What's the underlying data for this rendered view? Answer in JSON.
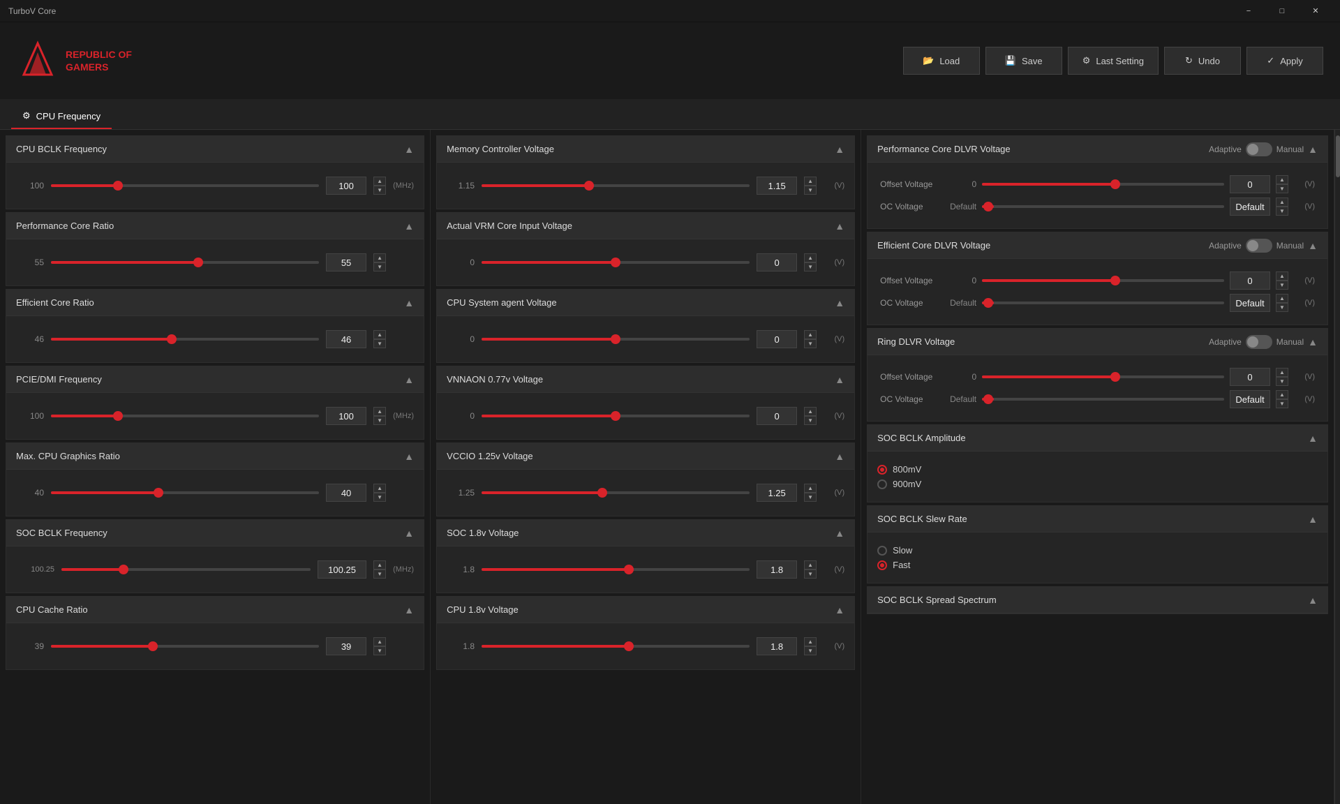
{
  "app": {
    "title": "TurboV Core",
    "titlebar_controls": [
      "minimize",
      "maximize",
      "close"
    ]
  },
  "toolbar": {
    "load_label": "Load",
    "save_label": "Save",
    "last_setting_label": "Last Setting",
    "undo_label": "Undo",
    "apply_label": "Apply"
  },
  "nav": {
    "tabs": [
      {
        "id": "cpu-frequency",
        "label": "CPU Frequency",
        "active": true
      }
    ]
  },
  "col1": {
    "sections": [
      {
        "id": "cpu-bclk-freq",
        "title": "CPU BCLK Frequency",
        "value": "100",
        "display": "100",
        "unit": "(MHz)",
        "fill_pct": 25
      },
      {
        "id": "perf-core-ratio",
        "title": "Performance Core Ratio",
        "value": "55",
        "display": "55",
        "unit": "",
        "fill_pct": 55
      },
      {
        "id": "eff-core-ratio",
        "title": "Efficient Core Ratio",
        "value": "46",
        "display": "46",
        "unit": "",
        "fill_pct": 45
      },
      {
        "id": "pcie-dmi-freq",
        "title": "PCIE/DMI Frequency",
        "value": "100",
        "display": "100",
        "unit": "(MHz)",
        "fill_pct": 25
      },
      {
        "id": "max-cpu-graphics",
        "title": "Max. CPU Graphics Ratio",
        "value": "40",
        "display": "40",
        "unit": "",
        "fill_pct": 40
      },
      {
        "id": "soc-bclk-freq",
        "title": "SOC BCLK Frequency",
        "value": "100.25",
        "display": "100.25",
        "unit": "(MHz)",
        "fill_pct": 25
      },
      {
        "id": "cpu-cache-ratio",
        "title": "CPU Cache Ratio",
        "value": "39",
        "display": "39",
        "unit": "",
        "fill_pct": 38
      }
    ]
  },
  "col2": {
    "sections": [
      {
        "id": "mem-ctrl-voltage",
        "title": "Memory Controller Voltage",
        "value": "1.15",
        "display": "1.15",
        "unit": "(V)",
        "fill_pct": 40
      },
      {
        "id": "actual-vrm-voltage",
        "title": "Actual VRM Core Input Voltage",
        "value": "0",
        "display": "0",
        "unit": "(V)",
        "fill_pct": 50
      },
      {
        "id": "cpu-sysagent-voltage",
        "title": "CPU System agent Voltage",
        "value": "0",
        "display": "0",
        "unit": "(V)",
        "fill_pct": 50
      },
      {
        "id": "vnnaon-voltage",
        "title": "VNNAON 0.77v Voltage",
        "value": "0",
        "display": "0",
        "unit": "(V)",
        "fill_pct": 50
      },
      {
        "id": "vccio-voltage",
        "title": "VCCIO 1.25v Voltage",
        "value": "1.25",
        "display": "1.25",
        "unit": "(V)",
        "fill_pct": 45
      },
      {
        "id": "soc-18v-voltage",
        "title": "SOC 1.8v Voltage",
        "value": "1.8",
        "display": "1.8",
        "unit": "(V)",
        "fill_pct": 55
      },
      {
        "id": "cpu-18v-voltage",
        "title": "CPU 1.8v Voltage",
        "value": "1.8",
        "display": "1.8",
        "unit": "(V)",
        "fill_pct": 55
      }
    ]
  },
  "col3": {
    "perf_core_dlvr": {
      "title": "Performance Core DLVR Voltage",
      "toggle_left": "Adaptive",
      "toggle_right": "Manual",
      "offset_label": "Offset Voltage",
      "offset_value": "0",
      "offset_display": "0",
      "offset_unit": "(V)",
      "oc_label": "OC Voltage",
      "oc_default": "Default",
      "oc_unit": "(V)"
    },
    "eff_core_dlvr": {
      "title": "Efficient Core DLVR Voltage",
      "toggle_left": "Adaptive",
      "toggle_right": "Manual",
      "offset_label": "Offset Voltage",
      "offset_value": "0",
      "offset_display": "0",
      "offset_unit": "(V)",
      "oc_label": "OC Voltage",
      "oc_default": "Default",
      "oc_unit": "(V)"
    },
    "ring_dlvr": {
      "title": "Ring DLVR Voltage",
      "toggle_left": "Adaptive",
      "toggle_right": "Manual",
      "offset_label": "Offset Voltage",
      "offset_value": "0",
      "offset_display": "0",
      "offset_unit": "(V)",
      "oc_label": "OC Voltage",
      "oc_default": "Default",
      "oc_unit": "(V)"
    },
    "soc_bclk_amp": {
      "title": "SOC BCLK Amplitude",
      "options": [
        {
          "label": "800mV",
          "active": true
        },
        {
          "label": "900mV",
          "active": false
        }
      ]
    },
    "soc_bclk_slew": {
      "title": "SOC BCLK Slew Rate",
      "options": [
        {
          "label": "Slow",
          "active": false
        },
        {
          "label": "Fast",
          "active": true
        }
      ]
    },
    "soc_bclk_spread": {
      "title": "SOC BCLK Spread Spectrum"
    }
  }
}
